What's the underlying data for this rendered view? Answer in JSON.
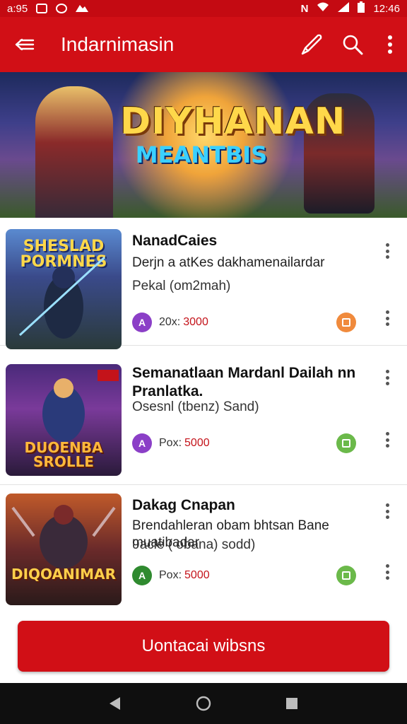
{
  "status_bar": {
    "time_left": "a:95",
    "time_right": "12:46"
  },
  "app_bar": {
    "title": "Indarnimasin"
  },
  "banner": {
    "logo_line1": "DIYHANAN",
    "logo_line2": "MEANTBIS"
  },
  "items": [
    {
      "title": "NanadCaies",
      "desc": "Derjn a atKes dakhamenailardar",
      "sub": "Pekal (om2mah)",
      "badge_icon": "A",
      "meta": "20x:",
      "price": "3000",
      "thumb_caption_top": "SHESLAD PORMNES",
      "thumb_caption_bottom": "",
      "badge_color": "#8b3fc7",
      "status_color": "#f08a3c"
    },
    {
      "title": "Semanatlaan Mardanl Dailah nn Pranlatka.",
      "desc": "",
      "sub": "Osesnl (tbenz) Sand)",
      "badge_icon": "A",
      "meta": "Pox:",
      "price": "5000",
      "thumb_caption_top": "",
      "thumb_caption_bottom": "DUOENBA SROLLE",
      "badge_color": "#8b3fc7",
      "status_color": "#6bb94a"
    },
    {
      "title": "Dakag Cnapan",
      "desc": "Brendahleran obam bhtsan Bane muatibadar",
      "sub": "9acle ( obana) sodd)",
      "badge_icon": "A",
      "meta": "Pox:",
      "price": "5000",
      "thumb_caption_top": "",
      "thumb_caption_bottom": "DIQOANIMAR",
      "badge_color": "#2f8a2f",
      "status_color": "#6bb94a"
    }
  ],
  "cta": {
    "label": "Uontacai wibsns"
  }
}
